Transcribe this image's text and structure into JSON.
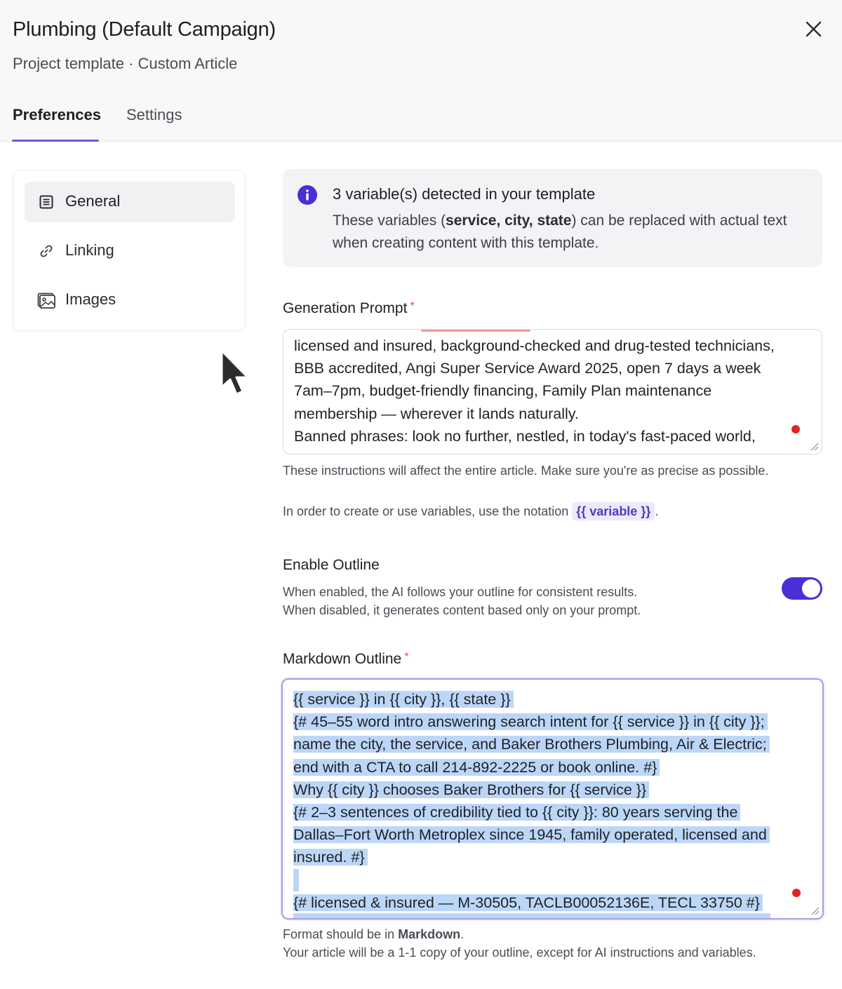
{
  "header": {
    "title": "Plumbing (Default Campaign)",
    "subtitle": "Project template · Custom Article",
    "tabs": [
      {
        "label": "Preferences",
        "active": true
      },
      {
        "label": "Settings",
        "active": false
      }
    ]
  },
  "sidebar": {
    "items": [
      {
        "label": "General",
        "icon": "list-document-icon",
        "active": true
      },
      {
        "label": "Linking",
        "icon": "link-icon",
        "active": false
      },
      {
        "label": "Images",
        "icon": "images-icon",
        "active": false
      }
    ]
  },
  "info": {
    "title": "3 variable(s) detected in your template",
    "text_before": "These variables (",
    "variables": "service, city, state",
    "text_after": ") can be replaced with actual text when creating content with this template."
  },
  "prompt": {
    "label": "Generation Prompt",
    "required_mark": "*",
    "lines": [
      "licensed and insured, background-checked and drug-tested technicians,",
      "BBB accredited, Angi Super Service Award 2025, open 7 days a week",
      "7am–7pm, budget-friendly financing, Family Plan maintenance",
      "membership — wherever it lands naturally.",
      "Banned phrases: look no further, nestled, in today's fast-paced world,"
    ],
    "help_text": "These instructions will affect the entire article. Make sure you're as precise as possible.",
    "variable_help_before": "In order to create or use variables, use the notation",
    "variable_chip": "{{ variable }}",
    "variable_help_after": "."
  },
  "outline_toggle": {
    "label": "Enable Outline",
    "desc_line1": "When enabled, the AI follows your outline for consistent results.",
    "desc_line2": "When disabled, it generates content based only on your prompt.",
    "enabled": true,
    "accent_color": "#4a2fd6"
  },
  "outline": {
    "label": "Markdown Outline",
    "required_mark": "*",
    "lines": [
      "{{ service }} in {{ city }}, {{ state }}",
      "{# 45–55 word intro answering search intent for {{ service }} in {{ city }};",
      "name the city, the service, and Baker Brothers Plumbing, Air & Electric;",
      "end with a CTA to call 214-892-2225 or book online. #}",
      "Why {{ city }} chooses Baker Brothers for {{ service }}",
      "{# 2–3 sentences of credibility tied to {{ city }}: 80 years serving the",
      "Dallas–Fort Worth Metroplex since 1945, family operated, licensed and",
      "insured. #}",
      "",
      "{# licensed & insured — M-30505, TACLB00052136E, TECL 33750 #}"
    ],
    "format_before": "Format should be in ",
    "format_bold": "Markdown",
    "format_after": ".",
    "copy_text": "Your article will be a 1-1 copy of your outline, except for AI instructions and variables."
  }
}
